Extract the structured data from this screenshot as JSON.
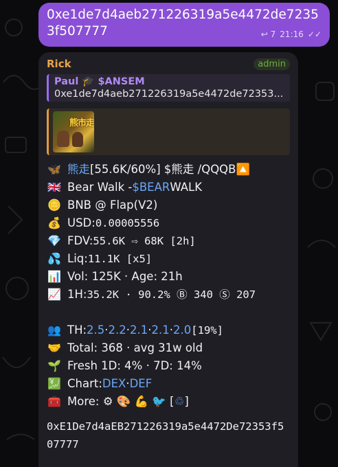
{
  "outgoing": {
    "text": "0xe1de7d4aeb271226319a5e4472de72353f507777",
    "reply_count": "7",
    "time": "21:16",
    "read_mark": "✓✓"
  },
  "incoming": {
    "sender": "Rick",
    "role": "admin",
    "reply": {
      "name": "Paul 🎓 $ANSEM",
      "text": "0xe1de7d4aeb271226319a5e4472de72353..."
    },
    "preview_image_text": "熊市走",
    "lines": [
      {
        "icon": "🦋",
        "parts": [
          {
            "t": "熊走",
            "link": true
          },
          {
            "t": " [55.6K/60%] $熊走 /QQQB "
          },
          {
            "t": "🔼"
          }
        ]
      },
      {
        "icon": "🇬🇧",
        "parts": [
          {
            "t": "Bear Walk - "
          },
          {
            "t": "$BEAR",
            "link": true
          },
          {
            "t": " WALK"
          }
        ]
      },
      {
        "icon": "🪙",
        "parts": [
          {
            "t": "BNB @ Flap "
          },
          {
            "t": "(V2)"
          }
        ]
      },
      {
        "icon": "💰",
        "parts": [
          {
            "t": "USD: "
          },
          {
            "t": "0.00005556",
            "mono": true
          }
        ]
      },
      {
        "icon": "💎",
        "parts": [
          {
            "t": "FDV: "
          },
          {
            "t": "55.6K ⇨ 68K [2h]",
            "mono": true
          }
        ]
      },
      {
        "icon": "💦",
        "parts": [
          {
            "t": "Liq: "
          },
          {
            "t": "11.1K [x5]",
            "mono": true
          }
        ]
      },
      {
        "icon": "📊",
        "parts": [
          {
            "t": "Vol: 125K · Age: 21h"
          }
        ]
      },
      {
        "icon": "📈",
        "parts": [
          {
            "t": "1H: "
          },
          {
            "t": "35.2K · 90.2% Ⓑ 340 Ⓢ 207",
            "mono": true
          }
        ]
      },
      {
        "icon": "",
        "parts": []
      },
      {
        "icon": "👥",
        "parts": [
          {
            "t": "TH: "
          },
          {
            "t": "2.5",
            "link": true
          },
          {
            "t": "·"
          },
          {
            "t": "2.2",
            "link": true
          },
          {
            "t": "·"
          },
          {
            "t": "2.1",
            "link": true
          },
          {
            "t": "·"
          },
          {
            "t": "2.1",
            "link": true
          },
          {
            "t": "·"
          },
          {
            "t": "2.0",
            "link": true
          },
          {
            "t": " [19%]",
            "mono": true
          }
        ]
      },
      {
        "icon": "🤝",
        "parts": [
          {
            "t": "Total: 368 · avg 31w old"
          }
        ]
      },
      {
        "icon": "🌱",
        "parts": [
          {
            "t": "Fresh 1D: 4% · 7D: 14%"
          }
        ]
      },
      {
        "icon": "💹",
        "parts": [
          {
            "t": "Chart: "
          },
          {
            "t": "DEX",
            "link": true
          },
          {
            "t": "·"
          },
          {
            "t": "DEF",
            "link": true
          }
        ]
      },
      {
        "icon": "🧰",
        "parts": [
          {
            "t": "More: ⚙ 🎨 💪 🐦 ["
          },
          {
            "t": "♲",
            "link": true
          },
          {
            "t": "]"
          }
        ]
      }
    ],
    "contract": "0xE1De7d4aEB271226319a5e4472De72353f507777"
  }
}
